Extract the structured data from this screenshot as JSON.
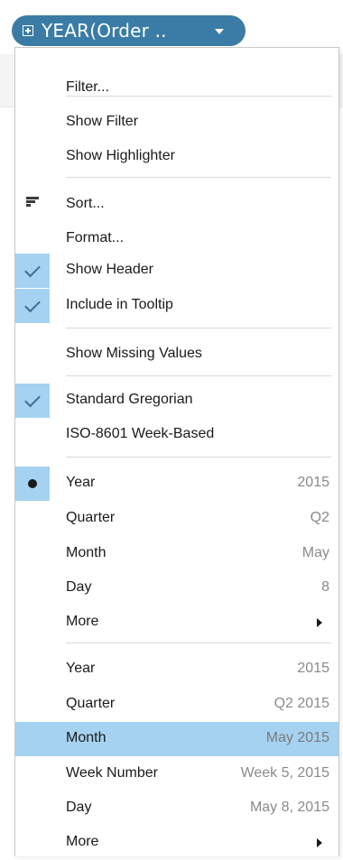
{
  "pill": {
    "label": "YEAR(Order ..",
    "icon": "plus-box-icon",
    "dropdown_icon": "caret-down-icon"
  },
  "colors": {
    "pill": "#3a7ca5",
    "highlight": "#a5d2f1",
    "check": "#3d6e94"
  },
  "menu": {
    "filter": "Filter...",
    "show_filter": "Show Filter",
    "show_highlighter": "Show Highlighter",
    "sort": "Sort...",
    "format": "Format...",
    "show_header": "Show Header",
    "include_in_tooltip": "Include in Tooltip",
    "show_missing_values": "Show Missing Values",
    "standard_gregorian": "Standard Gregorian",
    "iso_week_based": "ISO-8601 Week-Based",
    "discrete": {
      "year": {
        "label": "Year",
        "value": "2015"
      },
      "quarter": {
        "label": "Quarter",
        "value": "Q2"
      },
      "month": {
        "label": "Month",
        "value": "May"
      },
      "day": {
        "label": "Day",
        "value": "8"
      },
      "more": {
        "label": "More"
      }
    },
    "continuous": {
      "year": {
        "label": "Year",
        "value": "2015"
      },
      "quarter": {
        "label": "Quarter",
        "value": "Q2 2015"
      },
      "month": {
        "label": "Month",
        "value": "May 2015"
      },
      "week_number": {
        "label": "Week Number",
        "value": "Week 5, 2015"
      },
      "day": {
        "label": "Day",
        "value": "May 8, 2015"
      },
      "more": {
        "label": "More"
      }
    }
  }
}
